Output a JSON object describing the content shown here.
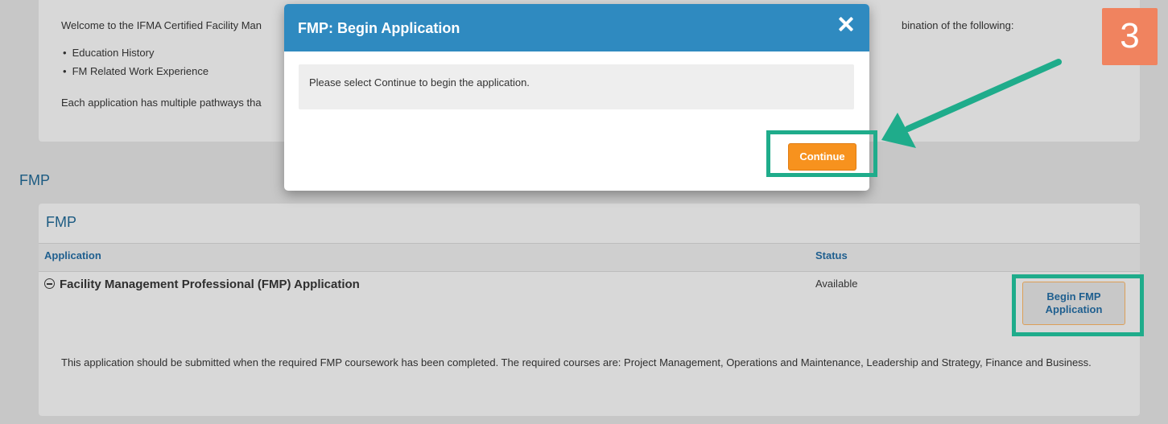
{
  "background": {
    "intro": {
      "line1_left": "Welcome to the IFMA Certified Facility Man",
      "line1_right": "bination of the following:",
      "bullets": [
        "Education History",
        "FM Related Work Experience"
      ],
      "line2_left": "Each application has multiple pathways tha"
    },
    "section_title": "FMP",
    "card_title": "FMP",
    "table": {
      "headers": {
        "application": "Application",
        "status": "Status"
      },
      "row": {
        "title": "Facility Management Professional (FMP) Application",
        "status": "Available",
        "button_label": "Begin FMP Application",
        "description": "This application should be submitted when the required FMP coursework has been completed. The required courses are:  Project Management, Operations and Maintenance, Leadership and Strategy, Finance and Business."
      }
    }
  },
  "modal": {
    "title": "FMP: Begin Application",
    "message": "Please select Continue to begin the application.",
    "continue_label": "Continue",
    "close_icon": "close-icon"
  },
  "annotations": {
    "step_number": "3",
    "highlight_color": "#1fac8b",
    "badge_color": "#f0835f"
  }
}
